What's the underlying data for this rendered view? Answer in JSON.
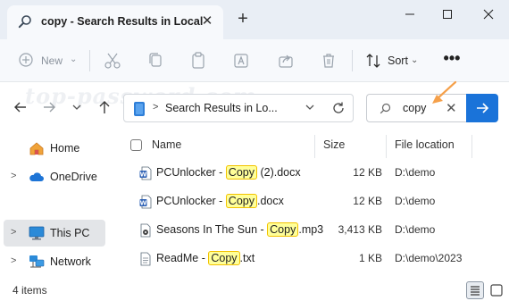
{
  "window": {
    "tab_title": "copy - Search Results in Local",
    "tab_close": "✕",
    "new_tab": "+"
  },
  "toolbar": {
    "new_label": "New",
    "sort_label": "Sort",
    "more_label": "•••"
  },
  "watermark": "top-password.com",
  "address": {
    "path_text": "Search Results in Lo...",
    "separator": ">"
  },
  "search": {
    "value": "copy",
    "clear": "✕"
  },
  "sidebar": {
    "items": [
      {
        "label": "Home",
        "expander": "",
        "icon": "home-icon",
        "selected": false
      },
      {
        "label": "OneDrive",
        "expander": ">",
        "icon": "cloud-icon",
        "selected": false
      },
      {
        "label": "This PC",
        "expander": ">",
        "icon": "monitor-icon",
        "selected": true
      },
      {
        "label": "Network",
        "expander": ">",
        "icon": "network-icon",
        "selected": false
      }
    ]
  },
  "columns": {
    "name": "Name",
    "size": "Size",
    "location": "File location"
  },
  "files": [
    {
      "prefix": "PCUnlocker - ",
      "match": "Copy",
      "suffix": " (2).docx",
      "size": "12 KB",
      "location": "D:\\demo",
      "icon": "word-doc-icon"
    },
    {
      "prefix": "PCUnlocker - ",
      "match": "Copy",
      "suffix": ".docx",
      "size": "12 KB",
      "location": "D:\\demo",
      "icon": "word-doc-icon"
    },
    {
      "prefix": "Seasons In The Sun - ",
      "match": "Copy",
      "suffix": ".mp3",
      "size": "3,413 KB",
      "location": "D:\\demo",
      "icon": "audio-file-icon"
    },
    {
      "prefix": "ReadMe - ",
      "match": "Copy",
      "suffix": ".txt",
      "size": "1 KB",
      "location": "D:\\demo\\2023",
      "icon": "text-file-icon"
    }
  ],
  "status": {
    "item_count": "4 items"
  },
  "colors": {
    "accent": "#1a73d9",
    "highlight": "#ffff99",
    "annotation_arrow": "#f5a04a"
  }
}
